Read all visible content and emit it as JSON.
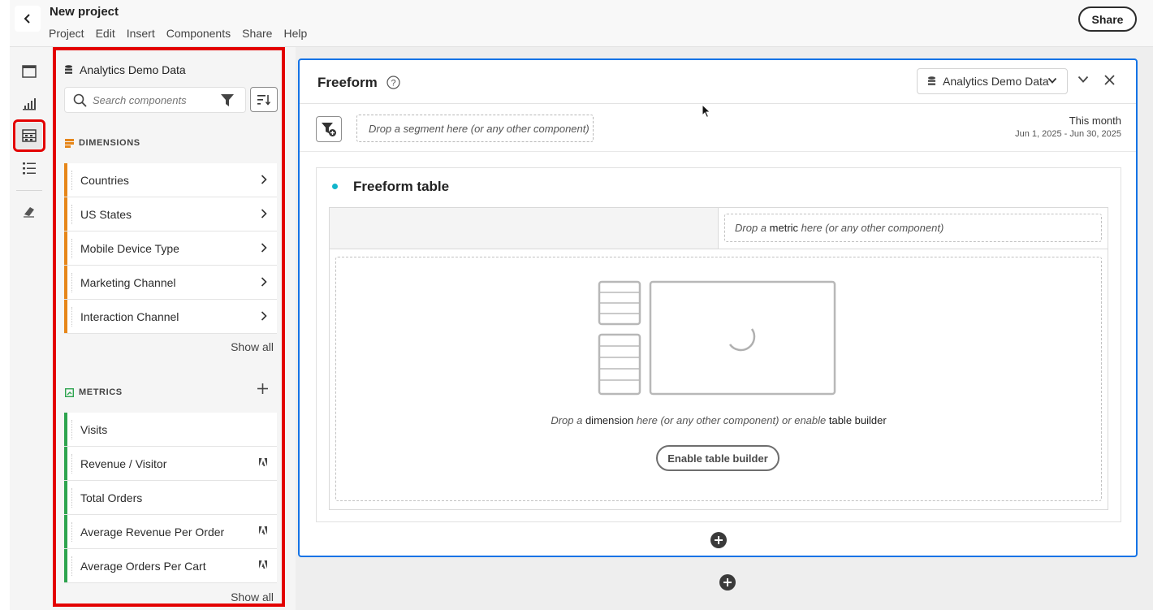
{
  "header": {
    "project_title": "New project",
    "menu": [
      "Project",
      "Edit",
      "Insert",
      "Components",
      "Share",
      "Help"
    ],
    "share_label": "Share"
  },
  "rail": {
    "icons": [
      "panel-icon",
      "visualization-icon",
      "components-icon",
      "list-icon",
      "eraser-icon"
    ],
    "selected": "components-icon"
  },
  "components_panel": {
    "data_source": "Analytics Demo Data",
    "search_placeholder": "Search components",
    "dimensions": {
      "title": "DIMENSIONS",
      "items": [
        "Countries",
        "US States",
        "Mobile Device Type",
        "Marketing Channel",
        "Interaction Channel"
      ],
      "show_all": "Show all"
    },
    "metrics": {
      "title": "METRICS",
      "items": [
        {
          "label": "Visits",
          "adobe_badge": false
        },
        {
          "label": "Revenue / Visitor",
          "adobe_badge": true
        },
        {
          "label": "Total Orders",
          "adobe_badge": false
        },
        {
          "label": "Average Revenue Per Order",
          "adobe_badge": true
        },
        {
          "label": "Average Orders Per Cart",
          "adobe_badge": true
        }
      ],
      "show_all": "Show all"
    },
    "colors": {
      "dimension_accent": "#e68619",
      "metric_accent": "#2da44e",
      "highlight": "#e30000"
    }
  },
  "freeform": {
    "title": "Freeform",
    "data_source": "Analytics Demo Data",
    "segment_drop": "Drop a segment here (or any other component)",
    "date_range_label": "This month",
    "date_range": "Jun 1, 2025 - Jun 30, 2025",
    "table": {
      "title": "Freeform table",
      "metric_drop_prefix": "Drop a ",
      "metric_drop_keyword": "metric",
      "metric_drop_suffix": " here (or any other component)",
      "dim_drop_prefix": "Drop a ",
      "dim_drop_keyword": "dimension",
      "dim_drop_middle": " here (or any other component) or enable ",
      "dim_drop_keyword2": "table builder",
      "enable_button": "Enable table builder"
    },
    "accent_color": "#1473e6"
  }
}
